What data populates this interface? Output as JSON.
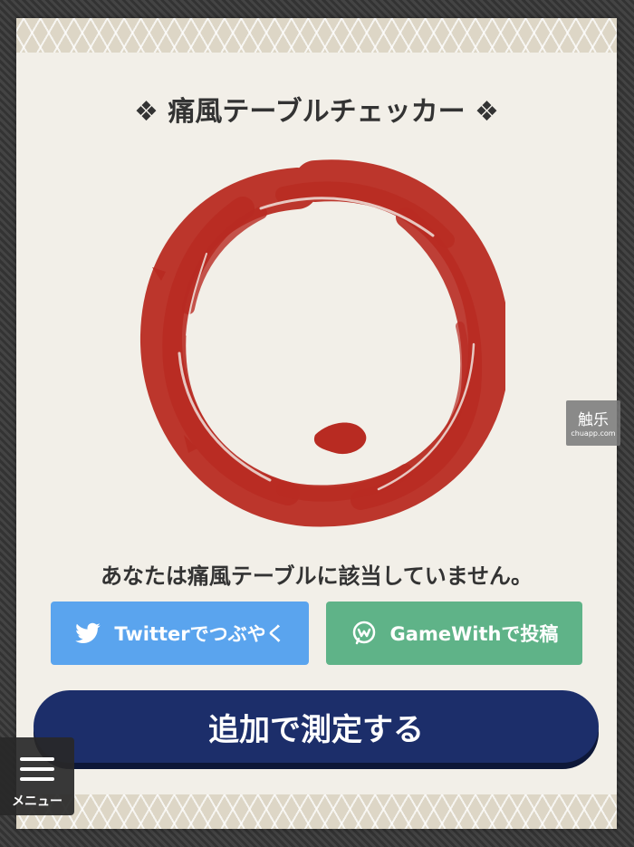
{
  "title": "❖ 痛風テーブルチェッカー ❖",
  "result_text": "あなたは痛風テーブルに該当していません。",
  "share": {
    "twitter_label": "Twitterでつぶやく",
    "gamewith_label": "GameWithで投稿"
  },
  "measure_button_label": "追加で測定する",
  "menu": {
    "label": "メニュー"
  },
  "watermark": {
    "main": "触乐",
    "sub": "chuapp.com"
  },
  "icons": {
    "twitter": "twitter-bird-icon",
    "gamewith": "gamewith-icon",
    "menu": "hamburger-menu-icon",
    "result": "enso-circle-icon"
  },
  "colors": {
    "twitter": "#5aa4ee",
    "gamewith": "#5fb388",
    "measure_button": "#1c2e6a",
    "enso": "#b82b22",
    "card_bg": "#f2efe8"
  }
}
